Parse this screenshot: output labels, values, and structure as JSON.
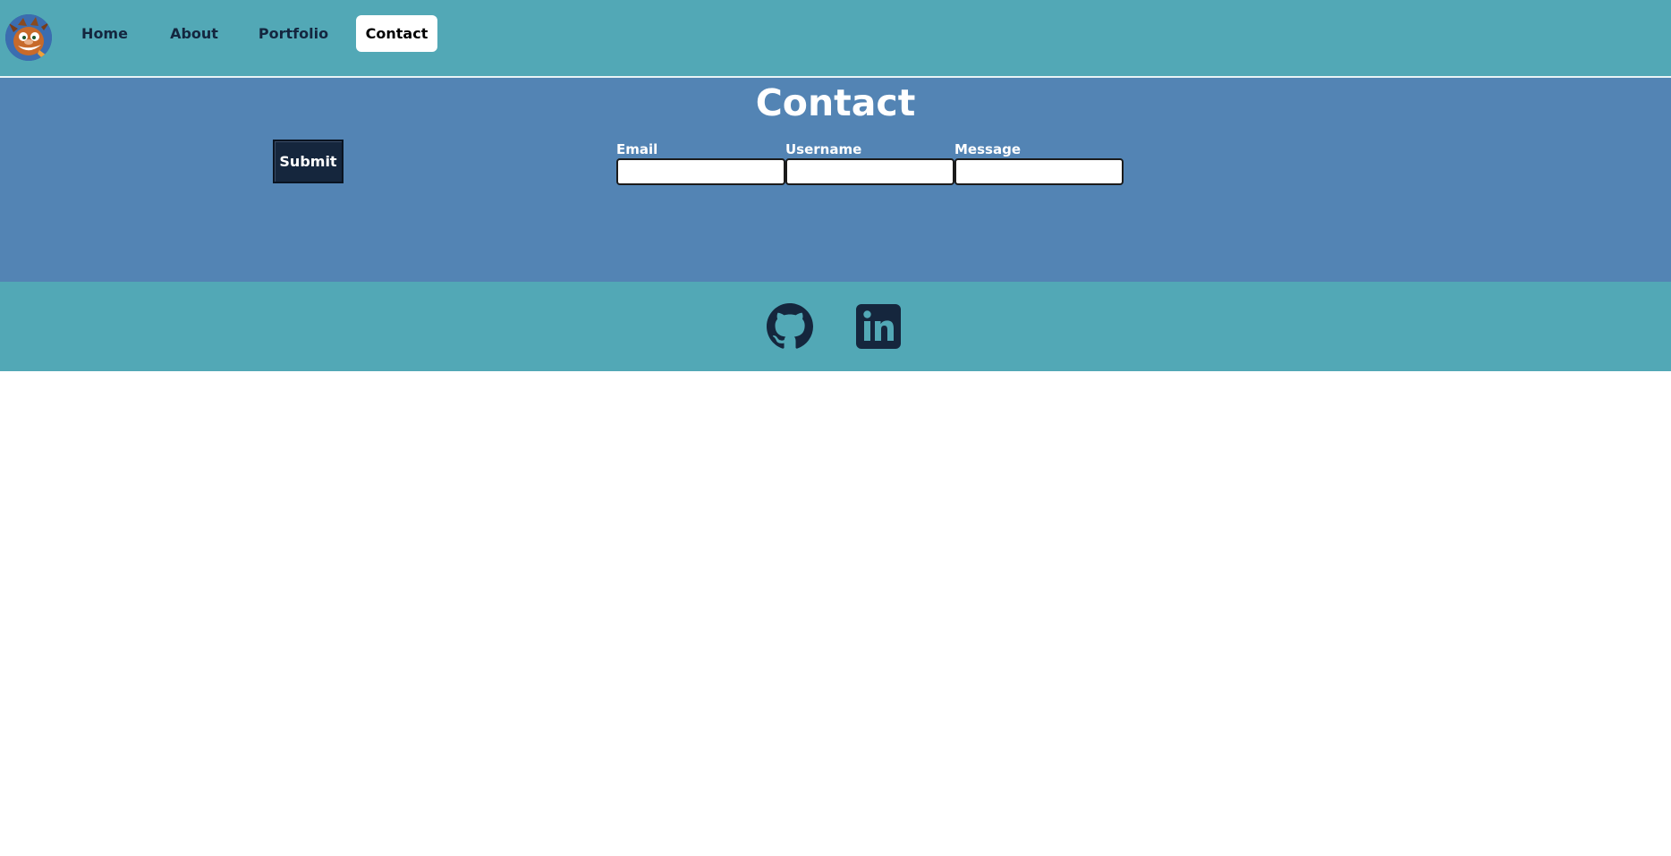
{
  "nav": {
    "items": [
      {
        "label": "Home"
      },
      {
        "label": "About"
      },
      {
        "label": "Portfolio"
      },
      {
        "label": "Contact",
        "active": true
      }
    ],
    "logo_icon": "avatar-cartoon-character-icon"
  },
  "contact": {
    "title": "Contact",
    "submit_label": "Submit",
    "fields": {
      "email": {
        "label": "Email",
        "value": ""
      },
      "username": {
        "label": "Username",
        "value": ""
      },
      "message": {
        "label": "Message",
        "value": ""
      }
    }
  },
  "footer": {
    "icons": [
      "github-icon",
      "linkedin-icon"
    ]
  },
  "colors": {
    "nav_bg": "#52a8b6",
    "section_bg": "#5384b4",
    "dark": "#15263d",
    "white": "#ffffff"
  }
}
